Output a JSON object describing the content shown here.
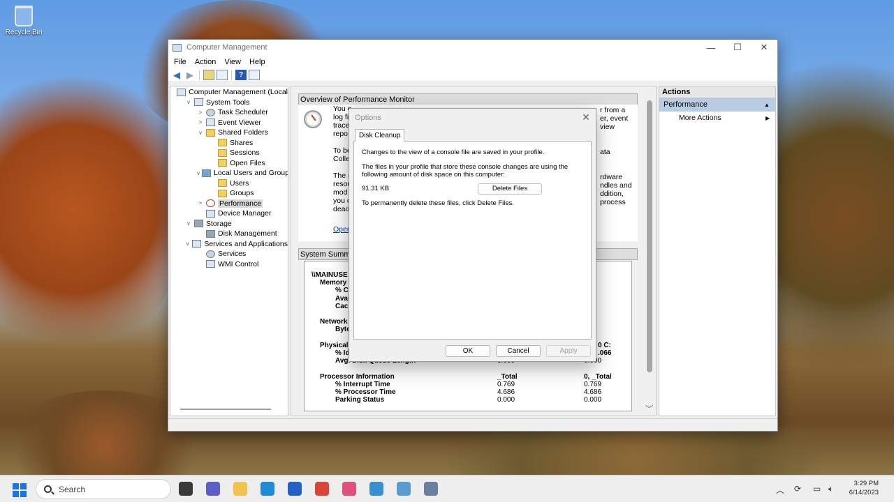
{
  "desktop": {
    "recycle_bin": "Recycle Bin"
  },
  "window": {
    "title": "Computer Management",
    "controls": {
      "minimize": "—",
      "maximize": "☐",
      "close": "✕"
    }
  },
  "menu": [
    "File",
    "Action",
    "View",
    "Help"
  ],
  "tree": [
    {
      "label": "Computer Management (Local",
      "depth": 0,
      "expander": "",
      "icon": "computer-management-icon"
    },
    {
      "label": "System Tools",
      "depth": 1,
      "expander": "v",
      "icon": "tools-icon"
    },
    {
      "label": "Task Scheduler",
      "depth": 2,
      "expander": ">",
      "icon": "clock-icon"
    },
    {
      "label": "Event Viewer",
      "depth": 2,
      "expander": ">",
      "icon": "event-viewer-icon"
    },
    {
      "label": "Shared Folders",
      "depth": 2,
      "expander": "v",
      "icon": "shared-folder-icon"
    },
    {
      "label": "Shares",
      "depth": 3,
      "expander": "",
      "icon": "shared-folder-icon"
    },
    {
      "label": "Sessions",
      "depth": 3,
      "expander": "",
      "icon": "shared-folder-icon"
    },
    {
      "label": "Open Files",
      "depth": 3,
      "expander": "",
      "icon": "shared-folder-icon"
    },
    {
      "label": "Local Users and Groups",
      "depth": 2,
      "expander": "v",
      "icon": "users-icon"
    },
    {
      "label": "Users",
      "depth": 3,
      "expander": "",
      "icon": "folder-icon"
    },
    {
      "label": "Groups",
      "depth": 3,
      "expander": "",
      "icon": "folder-icon"
    },
    {
      "label": "Performance",
      "depth": 2,
      "expander": ">",
      "icon": "performance-icon",
      "selected": true
    },
    {
      "label": "Device Manager",
      "depth": 2,
      "expander": "",
      "icon": "device-manager-icon"
    },
    {
      "label": "Storage",
      "depth": 1,
      "expander": "v",
      "icon": "storage-icon"
    },
    {
      "label": "Disk Management",
      "depth": 2,
      "expander": "",
      "icon": "disk-icon"
    },
    {
      "label": "Services and Applications",
      "depth": 1,
      "expander": "v",
      "icon": "services-apps-icon"
    },
    {
      "label": "Services",
      "depth": 2,
      "expander": "",
      "icon": "gear-icon"
    },
    {
      "label": "WMI Control",
      "depth": 2,
      "expander": "",
      "icon": "wmi-icon"
    }
  ],
  "overview": {
    "header": "Overview of Performance Monitor",
    "left_lines": [
      "You c",
      "log fi",
      "trace",
      "repo",
      "",
      "To be",
      "Colle",
      "",
      "The r",
      "resou",
      "mod",
      "you c",
      "dead"
    ],
    "right_lines": [
      "r from a",
      "er, event",
      "view",
      "",
      "",
      "ata",
      "",
      "",
      "rdware",
      "ndles and",
      "ddition,",
      "process"
    ],
    "link": "Open"
  },
  "summary": {
    "header": "System Summa",
    "rows": [
      {
        "label": "\\\\MAINUSE",
        "indent": 0,
        "t": 0
      },
      {
        "label": "Memory",
        "indent": 1,
        "t": 1
      },
      {
        "label": "% Co",
        "indent": 2,
        "t": 2
      },
      {
        "label": "Avai",
        "indent": 2,
        "t": 3
      },
      {
        "label": "Cach",
        "indent": 2,
        "t": 4
      },
      {
        "label": "Network",
        "indent": 1,
        "t": 6
      },
      {
        "label": "Byte",
        "indent": 2,
        "t": 7
      },
      {
        "label": "PhysicalD",
        "indent": 1,
        "t": 9
      },
      {
        "label": "% Id",
        "indent": 2,
        "t": 10
      },
      {
        "label": "Avg. Disk Queue Length",
        "indent": 2,
        "t": 11,
        "v1": "0.000",
        "v2": "0.000"
      },
      {
        "label": "Processor Information",
        "indent": 1,
        "t": 13,
        "v1": "_Total",
        "v2": "0, _Total",
        "bold": true
      },
      {
        "label": "% Interrupt Time",
        "indent": 2,
        "t": 14,
        "v1": "0.769",
        "v2": "0.769"
      },
      {
        "label": "% Processor Time",
        "indent": 2,
        "t": 15,
        "v1": "4.686",
        "v2": "4.686"
      },
      {
        "label": "Parking Status",
        "indent": 2,
        "t": 16,
        "v1": "0.000",
        "v2": "0.000"
      }
    ],
    "right_fragments": {
      "row9": "0 C:",
      "row10": ".066"
    }
  },
  "actions": {
    "header": "Actions",
    "sub": "Performance",
    "sub_arrow": "▲",
    "item": "More Actions",
    "item_arrow": "▶"
  },
  "dialog": {
    "title": "Options",
    "close": "✕",
    "tab": "Disk Cleanup",
    "line1": "Changes to the view of a console file are saved in your profile.",
    "line2": "The files in your profile that store these console changes are using the following amount of disk space on this computer:",
    "size": "91.31 KB",
    "delete_button": "Delete Files",
    "line3": "To permanently delete these files, click Delete Files.",
    "ok": "OK",
    "cancel": "Cancel",
    "apply": "Apply"
  },
  "taskbar": {
    "search_placeholder": "Search",
    "time": "3:29 PM",
    "date": "6/14/2023",
    "apps": [
      {
        "name": "task-view-icon",
        "color": "#3a3a3a"
      },
      {
        "name": "chat-icon",
        "color": "#5b5fc7"
      },
      {
        "name": "file-explorer-icon",
        "color": "#f2c14e"
      },
      {
        "name": "edge-icon",
        "color": "#1e8bd6"
      },
      {
        "name": "store-icon",
        "color": "#2461c5"
      },
      {
        "name": "chrome-icon",
        "color": "#db4437"
      },
      {
        "name": "snipping-icon",
        "color": "#e0507a"
      },
      {
        "name": "remote-desktop-icon",
        "color": "#3a8fd1"
      },
      {
        "name": "control-panel-icon",
        "color": "#5a9bd4"
      },
      {
        "name": "computer-management-app-icon",
        "color": "#6a7ea0"
      }
    ]
  }
}
